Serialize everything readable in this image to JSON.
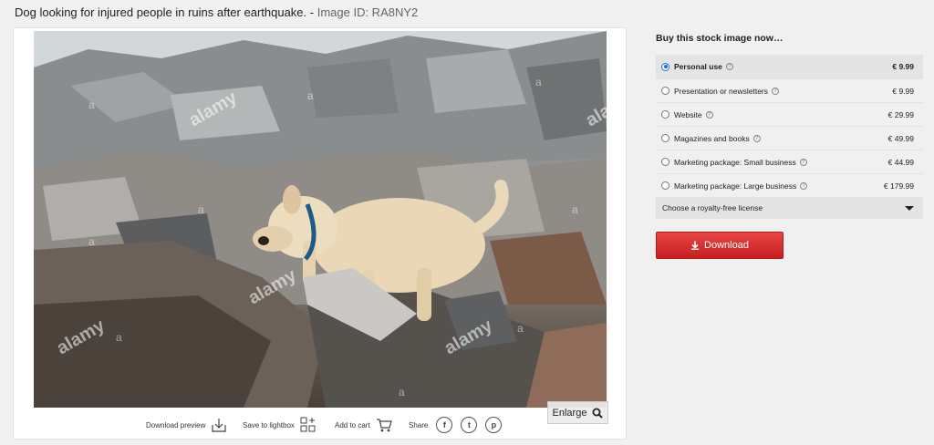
{
  "page": {
    "title": "Dog looking for injured people in ruins after earthquake.",
    "separator": " - ",
    "image_id": "Image ID: RA8NY2"
  },
  "viewer": {
    "enlarge_label": "Enlarge",
    "watermark": "alamy",
    "actions": {
      "download_preview": "Download preview",
      "save_to_lightbox": "Save to lightbox",
      "add_to_cart": "Add to cart",
      "share": "Share"
    },
    "share_icons": [
      "facebook-icon",
      "twitter-icon",
      "pinterest-icon"
    ]
  },
  "buy": {
    "heading": "Buy this stock image now…",
    "options": [
      {
        "label": "Personal use",
        "price": "€ 9.99",
        "selected": true
      },
      {
        "label": "Presentation or newsletters",
        "price": "€ 9.99",
        "selected": false
      },
      {
        "label": "Website",
        "price": "€ 29.99",
        "selected": false
      },
      {
        "label": "Magazines and books",
        "price": "€ 49.99",
        "selected": false
      },
      {
        "label": "Marketing package: Small business",
        "price": "€ 44.99",
        "selected": false
      },
      {
        "label": "Marketing package: Large business",
        "price": "€ 179.99",
        "selected": false
      }
    ],
    "license_select": "Choose a royalty-free license",
    "download_label": "Download"
  },
  "colors": {
    "accent_red": "#d62f2f",
    "radio_blue": "#1a6fd6",
    "selected_row": "#e4e4e4"
  }
}
